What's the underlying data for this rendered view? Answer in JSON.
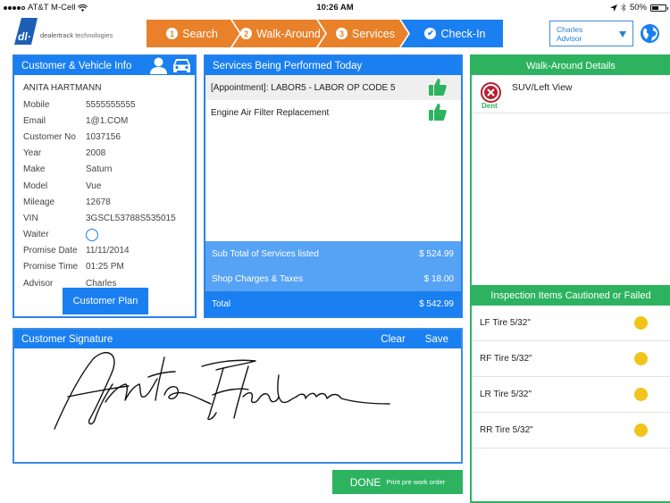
{
  "status_bar": {
    "carrier": "AT&T M-Cell",
    "time": "10:26 AM",
    "battery": "50%",
    "battery_level": 0.5
  },
  "logo": {
    "brand": "dealertrack",
    "suffix": "technologies"
  },
  "steps": [
    {
      "number": "1",
      "label": "Search",
      "state": "done"
    },
    {
      "number": "2",
      "label": "Walk-Around",
      "state": "done"
    },
    {
      "number": "3",
      "label": "Services",
      "state": "done"
    },
    {
      "number": "check",
      "label": "Check-In",
      "state": "active"
    }
  ],
  "advisor_select": {
    "line1": "Charles",
    "line2": "Advisor"
  },
  "customer_panel": {
    "title": "Customer & Vehicle Info",
    "customer_name": "ANITA HARTMANN",
    "fields": [
      {
        "label": "Mobile",
        "value": "5555555555"
      },
      {
        "label": "Email",
        "value": "1@1.COM"
      },
      {
        "label": "Customer No",
        "value": "1037156"
      },
      {
        "label": "Year",
        "value": "2008"
      },
      {
        "label": "Make",
        "value": "Saturn"
      },
      {
        "label": "Model",
        "value": "Vue"
      },
      {
        "label": "Mileage",
        "value": "12678"
      },
      {
        "label": "VIN",
        "value": "3GSCL53788S535015"
      },
      {
        "label": "Waiter",
        "value": ""
      },
      {
        "label": "Promise Date",
        "value": "11/11/2014"
      },
      {
        "label": "Promise Time",
        "value": "01:25 PM"
      },
      {
        "label": "Advisor",
        "value": "Charles"
      }
    ],
    "waiter_checked": false,
    "customer_plan_button": "Customer Plan"
  },
  "services_panel": {
    "title": "Services Being Performed Today",
    "services": [
      {
        "name": "[Appointment]: LABOR5 - LABOR OP CODE 5",
        "approved": true
      },
      {
        "name": "Engine Air Filter Replacement",
        "approved": true
      }
    ],
    "subtotal_label": "Sub Total of Services listed",
    "subtotal_value": "$ 524.99",
    "shop_label": "Shop Charges & Taxes",
    "shop_value": "$ 18.00",
    "total_label": "Total",
    "total_value": "$ 542.99"
  },
  "walkaround_panel": {
    "title": "Walk-Around Details",
    "items": [
      {
        "view": "SUV/Left View",
        "damage": "Dent"
      }
    ]
  },
  "inspection_panel": {
    "title": "Inspection Items Cautioned or Failed",
    "items": [
      {
        "label": "LF Tire 5/32\"",
        "status": "caution"
      },
      {
        "label": "RF Tire 5/32\"",
        "status": "caution"
      },
      {
        "label": "LR Tire 5/32\"",
        "status": "caution"
      },
      {
        "label": "RR Tire 5/32\"",
        "status": "caution"
      }
    ]
  },
  "signature_panel": {
    "title": "Customer Signature",
    "clear_label": "Clear",
    "save_label": "Save",
    "signer": "Anita Hartmann"
  },
  "done_button": {
    "label": "DONE",
    "sublabel": "Print pre work order"
  },
  "colors": {
    "primary_blue": "#1a7ff0",
    "light_blue": "#56a2f5",
    "step_orange": "#e8812a",
    "success_green": "#2db360",
    "caution_yellow": "#f0c419",
    "danger_red": "#b5202e"
  }
}
